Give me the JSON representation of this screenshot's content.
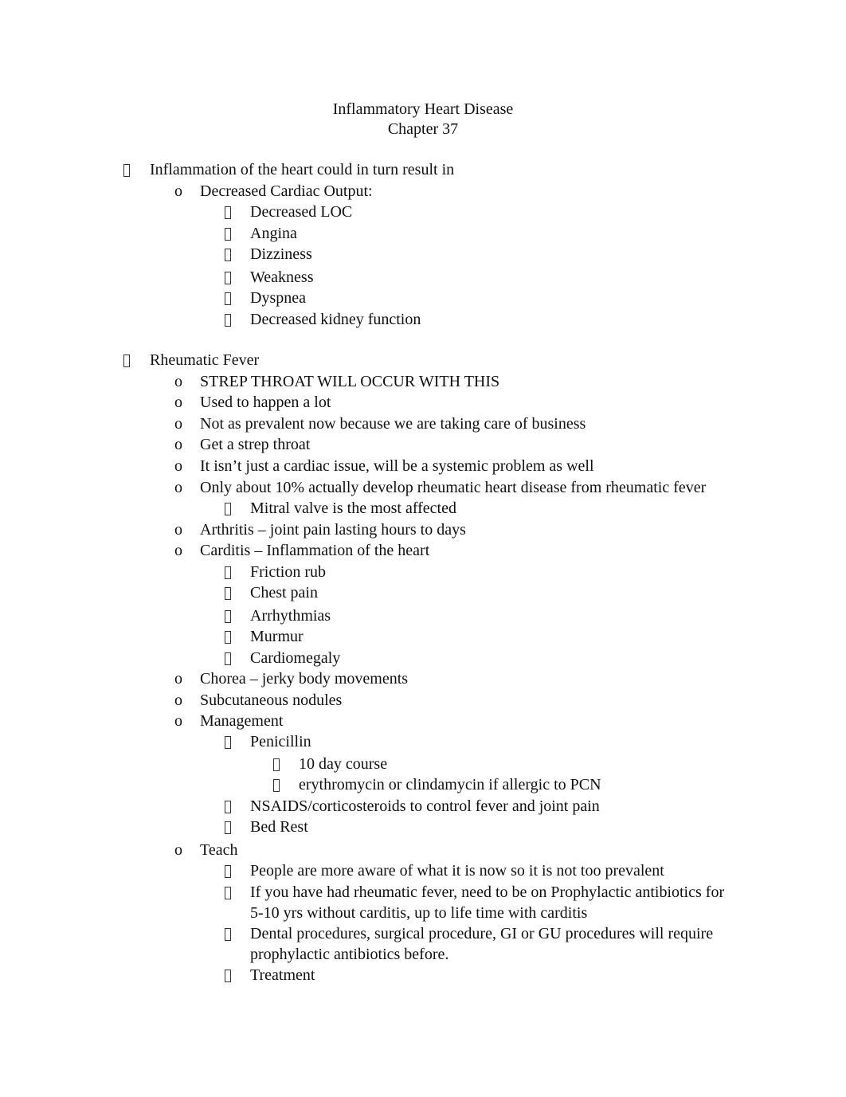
{
  "header": {
    "title": "Inflammatory Heart Disease",
    "subtitle": "Chapter 37"
  },
  "bullets": {
    "level0": "tofu-box",
    "level1": "o",
    "level2": "tofu-box",
    "level3": "tofu-box"
  },
  "lines": [
    {
      "level": 0,
      "text": "Inflammation of the heart could in turn result in"
    },
    {
      "level": 1,
      "text": "Decreased Cardiac Output:"
    },
    {
      "level": 2,
      "text": "Decreased LOC"
    },
    {
      "level": 2,
      "text": "Angina"
    },
    {
      "level": 2,
      "text": "Dizziness"
    },
    {
      "level": 2,
      "text": "Weakness"
    },
    {
      "level": 2,
      "text": "Dyspnea"
    },
    {
      "level": 2,
      "text": "Decreased kidney function"
    },
    {
      "level": 0,
      "text": "Rheumatic Fever"
    },
    {
      "level": 1,
      "text": "STREP THROAT WILL OCCUR WITH THIS"
    },
    {
      "level": 1,
      "text": "Used to happen a lot"
    },
    {
      "level": 1,
      "text": "Not as prevalent now because we are taking care of business"
    },
    {
      "level": 1,
      "text": "Get a strep throat"
    },
    {
      "level": 1,
      "text": "It isn’t just a cardiac issue, will be a systemic problem as well"
    },
    {
      "level": 1,
      "text": "Only about 10% actually develop rheumatic heart disease from rheumatic fever"
    },
    {
      "level": 2,
      "text": "Mitral valve is the most affected"
    },
    {
      "level": 1,
      "text": "Arthritis – joint pain lasting hours to days"
    },
    {
      "level": 1,
      "text": "Carditis – Inflammation of the heart"
    },
    {
      "level": 2,
      "text": "Friction rub"
    },
    {
      "level": 2,
      "text": "Chest pain"
    },
    {
      "level": 2,
      "text": "Arrhythmias"
    },
    {
      "level": 2,
      "text": "Murmur"
    },
    {
      "level": 2,
      "text": "Cardiomegaly"
    },
    {
      "level": 1,
      "text": "Chorea – jerky body movements"
    },
    {
      "level": 1,
      "text": "Subcutaneous nodules"
    },
    {
      "level": 1,
      "text": "Management"
    },
    {
      "level": 2,
      "text": "Penicillin"
    },
    {
      "level": 3,
      "text": "10 day course"
    },
    {
      "level": 3,
      "text": "erythromycin or clindamycin if allergic to PCN"
    },
    {
      "level": 2,
      "text": "NSAIDS/corticosteroids to control fever and joint pain"
    },
    {
      "level": 2,
      "text": "Bed Rest"
    },
    {
      "level": 1,
      "text": "Teach"
    },
    {
      "level": 2,
      "text": "People are more aware of what it is now so it is not too prevalent"
    },
    {
      "level": 2,
      "text": "If you have had rheumatic fever, need to be on Prophylactic antibiotics for"
    },
    {
      "level": 2,
      "text": "5-10 yrs without carditis, up to life time with carditis",
      "continuation": true
    },
    {
      "level": 2,
      "text": "Dental procedures, surgical procedure, GI or GU procedures will require"
    },
    {
      "level": 2,
      "text": "prophylactic antibiotics before.",
      "continuation": true
    },
    {
      "level": 2,
      "text": "Treatment"
    }
  ]
}
